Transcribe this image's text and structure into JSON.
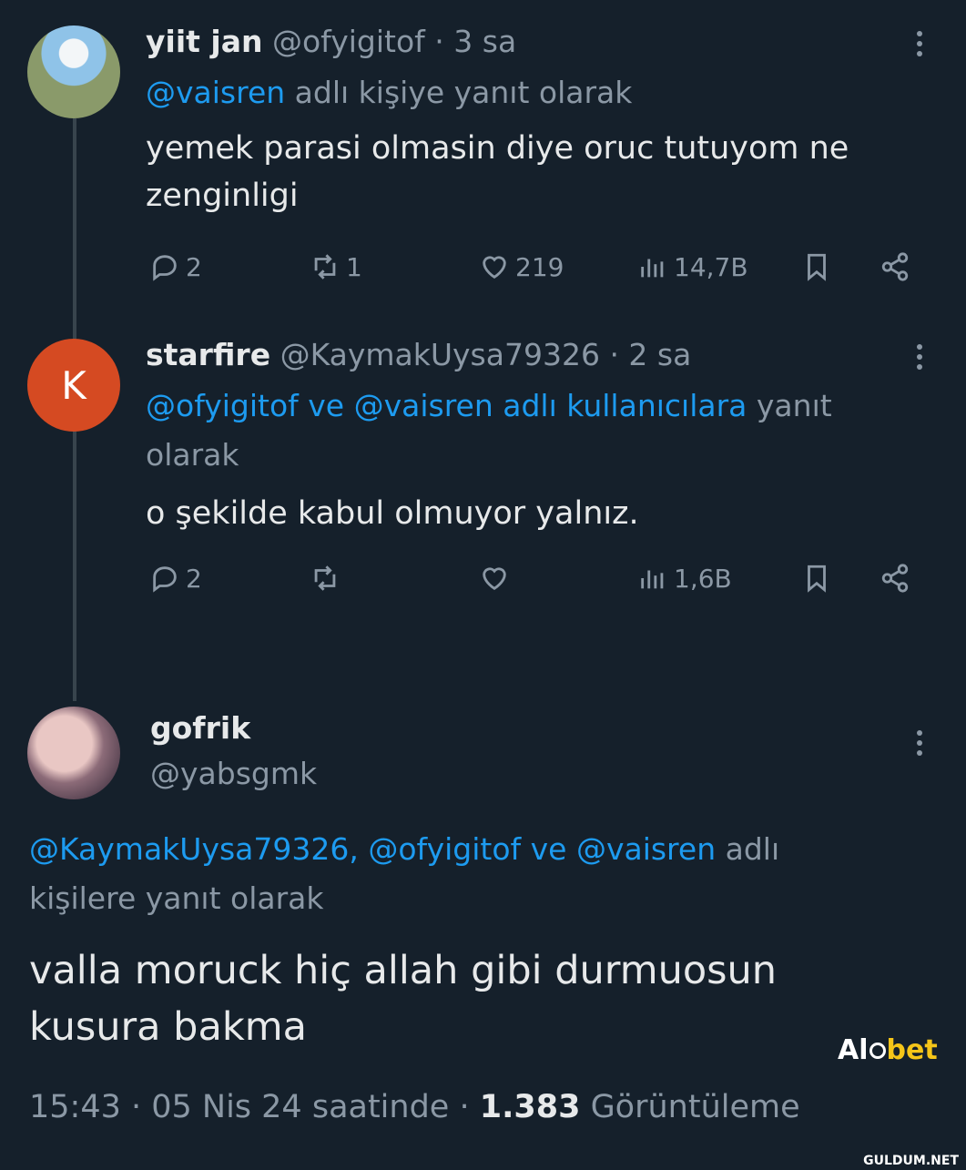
{
  "tweets": [
    {
      "name": "yiit jan",
      "handle": "@ofyigitof",
      "time": "· 3 sa",
      "reply_links": "@vaisren",
      "reply_rest": " adlı kişiye yanıt olarak",
      "text_line1": "yemek parasi olmasin diye oruc tutuyom ne",
      "text_line2": "zenginligi",
      "replies": "2",
      "retweets": "1",
      "likes": "219",
      "views": "14,7B"
    },
    {
      "avatar_letter": "K",
      "name": "starfire",
      "handle": "@KaymakUysa79326",
      "time": "· 2 sa",
      "reply_links": "@ofyigitof ve @vaisren adlı kullanıcılara",
      "reply_rest": " yanıt",
      "reply_line2": "olarak",
      "text_line1": "o şekilde kabul olmuyor yalnız.",
      "replies": "2",
      "retweets": "",
      "likes": "",
      "views": "1,6B"
    }
  ],
  "main": {
    "name": "gofrik",
    "handle": "@yabsgmk",
    "reply_links": "@KaymakUysa79326, @ofyigitof ve @vaisren",
    "reply_rest": " adlı",
    "reply_line2": "kişilere yanıt olarak",
    "text_line1": "valla moruck hiç allah gibi durmuosun",
    "text_line2": "kusura bakma",
    "footer_time": "15:43 · 05 Nis 24 saatinde · ",
    "footer_views": "1.383",
    "footer_views_label": " Görüntüleme"
  },
  "brand": {
    "a": "Al",
    "b": "bet"
  },
  "watermark": "GULDUM.NET",
  "colors": {
    "background": "#15202b",
    "link": "#1d9bf0",
    "muted": "#8b98a5",
    "text": "#e7e9ea"
  }
}
